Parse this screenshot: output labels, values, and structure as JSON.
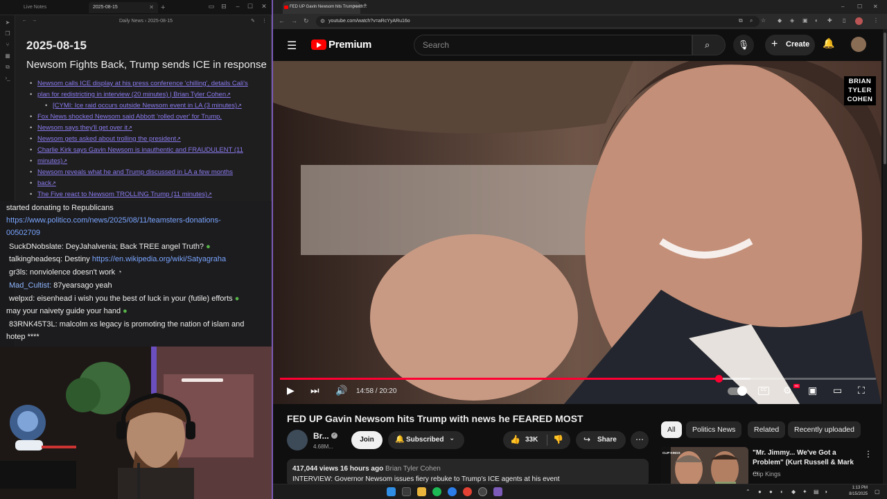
{
  "notes_app": {
    "tabs": [
      "Live Notes",
      "2025-08-15"
    ],
    "breadcrumb": "Daily News  ›  2025-08-15",
    "date_title": "2025-08-15",
    "heading": "Newsom Fights Back, Trump sends ICE in response",
    "items": [
      "Newsom calls ICE display at his press conference 'chilling', details Cali's",
      "plan for redistricting in interview (20 minutes) | Brian Tyler Cohen",
      "[CYMI: Ice raid occurs outside Newsom event in LA (3 minutes)",
      "Fox News shocked Newsom said Abbott 'rolled over' for Trump.",
      "Newsom says they'll get over it",
      "Newsom gets asked about trolling the president",
      "Charlie Kirk says Gavin Newsom is inauthentic and FRAUDULENT (11",
      "minutes)",
      "Newsom reveals what he and Trump discussed in LA a few months",
      "back",
      "The Five react to Newsom TROLLING Trump (11 minutes)"
    ]
  },
  "chat": {
    "lines": [
      {
        "text": "started donating to Republicans"
      },
      {
        "link": "https://www.politico.com/news/2025/08/11/teamsters-donations-"
      },
      {
        "link": "00502709"
      },
      {
        "text": "SuckDNobslate: DeyJahalvenia; Back TREE angel Truth?"
      },
      {
        "user": "talkingheadesq:",
        "text": "Destiny",
        "link": "https://en.wikipedia.org/wiki/Satyagraha"
      },
      {
        "user": "gr3ls:",
        "text": "nonviolence doesn't work"
      },
      {
        "user": "Mad_Cultist:",
        "text": "87yearsago yeah"
      },
      {
        "user": "welpxd:",
        "text": "eisenhead i wish you the best of luck in your (futile) efforts"
      },
      {
        "text": "may your naivety guide your hand"
      },
      {
        "user": "83RNK45T3L:",
        "text": "malcolm xs legacy is promoting the nation of islam and"
      },
      {
        "text": "hotep ****"
      }
    ]
  },
  "browser": {
    "tab_title": "FED UP Gavin Newsom hits Trump with...",
    "url": "youtube.com/watch?v=aRcYyARu16o"
  },
  "youtube": {
    "brand": "Premium",
    "search_placeholder": "Search",
    "create_label": "Create",
    "watermark": [
      "BRIAN",
      "TYLER",
      "COHEN"
    ],
    "time": "14:58 / 20:20",
    "progress": 0.736,
    "buffered": 0.79,
    "hd_badge": "HD",
    "cc_label": "CC",
    "video_title": "FED UP Gavin Newsom hits Trump with news he FEARED MOST",
    "channel_name": "Br...",
    "channel_subs": "4.68M...",
    "join_label": "Join",
    "subscribed_label": "Subscribed",
    "likes": "33K",
    "share_label": "Share",
    "views_meta": "417,044 views  16 hours ago",
    "desc_channel": "Brian Tyler Cohen",
    "desc_text": "INTERVIEW: Governor Newsom issues fiery rebuke to Trump's ICE agents at his event",
    "chips": [
      "All",
      "Politics News",
      "Related",
      "Recently uploaded"
    ],
    "reco_title": "\"Mr. Jimmy... We've Got a Problem\" (Kurt Russell & Mark ...",
    "reco_channel": "Clip Kings",
    "reco_thumb_text": "CLIP KINGS"
  },
  "taskbar": {
    "time": "1:13 PM",
    "date": "8/15/2025"
  },
  "colors": {
    "accent_red": "#ff0033",
    "notes_link": "#8b7cf0",
    "chat_link": "#7aa5ff"
  }
}
